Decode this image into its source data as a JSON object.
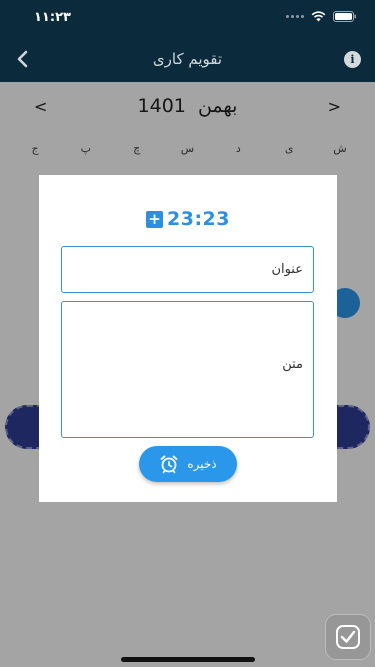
{
  "status_bar": {
    "time": "١١:٢٣"
  },
  "nav": {
    "title": "تقویم کاری",
    "back_icon": "chevron-left-icon",
    "info_icon": "info-icon",
    "info_label": "i"
  },
  "calendar": {
    "prev": "<",
    "next": ">",
    "month": "بهمن",
    "year": "1401",
    "weekdays": [
      "ش",
      "ی",
      "د",
      "س",
      "چ",
      "پ",
      "ج"
    ]
  },
  "dialog": {
    "add_icon": "plus-square-icon",
    "add_label": "+",
    "time": "23:23",
    "title_placeholder": "عنوان",
    "body_placeholder": "متن",
    "save_label": "ذخیره",
    "save_icon": "alarm-clock-icon"
  },
  "colors": {
    "nav_bg": "#0b2a3c",
    "accent": "#2d8fe3",
    "save_button": "#2a97ea"
  }
}
